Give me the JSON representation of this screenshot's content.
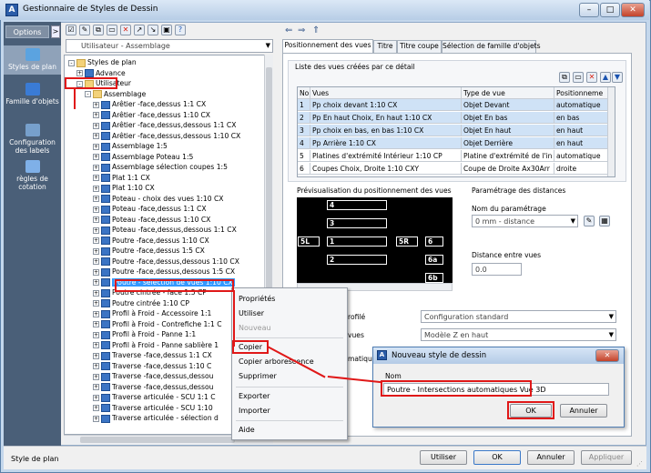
{
  "window": {
    "title": "Gestionnaire de Styles de Dessin"
  },
  "left_panel": {
    "options_label": "Options",
    "toggle": ">",
    "items": [
      {
        "label": "Styles de plan",
        "icon": "styles-plan-icon"
      },
      {
        "label": "Famille d'objets",
        "icon": "famille-objets-icon"
      },
      {
        "label": "Configuration des labels",
        "icon": "configuration-labels-icon"
      },
      {
        "label": "règles de cotation",
        "icon": "regles-cotation-icon"
      }
    ]
  },
  "filter_combo": {
    "value": "Utilisateur - Assemblage"
  },
  "tree": {
    "rows": [
      {
        "text": "Styles de plan",
        "indent": 0,
        "exp": "-",
        "folder": true
      },
      {
        "text": "Advance",
        "indent": 1,
        "exp": "+",
        "folder": false
      },
      {
        "text": "Utilisateur",
        "indent": 1,
        "exp": "-",
        "folder": true
      },
      {
        "text": "Assemblage",
        "indent": 2,
        "exp": "-",
        "folder": true
      },
      {
        "text": "Arêtier -face,dessus 1:1 CX",
        "indent": 3,
        "exp": "+",
        "folder": false
      },
      {
        "text": "Arêtier -face,dessus 1:10 CX",
        "indent": 3,
        "exp": "+",
        "folder": false
      },
      {
        "text": "Arêtier -face,dessus,dessous 1:1 CX",
        "indent": 3,
        "exp": "+",
        "folder": false
      },
      {
        "text": "Arêtier -face,dessus,dessous 1:10 CX",
        "indent": 3,
        "exp": "+",
        "folder": false
      },
      {
        "text": "Assemblage 1:5",
        "indent": 3,
        "exp": "+",
        "folder": false
      },
      {
        "text": "Assemblage Poteau 1:5",
        "indent": 3,
        "exp": "+",
        "folder": false
      },
      {
        "text": "Assemblage sélection coupes 1:5",
        "indent": 3,
        "exp": "+",
        "folder": false
      },
      {
        "text": "Plat 1:1 CX",
        "indent": 3,
        "exp": "+",
        "folder": false
      },
      {
        "text": "Plat 1:10 CX",
        "indent": 3,
        "exp": "+",
        "folder": false
      },
      {
        "text": "Poteau - choix des vues 1:10 CX",
        "indent": 3,
        "exp": "+",
        "folder": false
      },
      {
        "text": "Poteau -face,dessus 1:1 CX",
        "indent": 3,
        "exp": "+",
        "folder": false
      },
      {
        "text": "Poteau -face,dessus 1:10 CX",
        "indent": 3,
        "exp": "+",
        "folder": false
      },
      {
        "text": "Poteau -face,dessus,dessous 1:1 CX",
        "indent": 3,
        "exp": "+",
        "folder": false
      },
      {
        "text": "Poutre -face,dessus 1:10 CX",
        "indent": 3,
        "exp": "+",
        "folder": false
      },
      {
        "text": "Poutre -face,dessus 1:5 CX",
        "indent": 3,
        "exp": "+",
        "folder": false
      },
      {
        "text": "Poutre -face,dessus,dessous 1:10 CX",
        "indent": 3,
        "exp": "+",
        "folder": false
      },
      {
        "text": "Poutre -face,dessus,dessous 1:5 CX",
        "indent": 3,
        "exp": "+",
        "folder": false
      },
      {
        "text": "Poutre - sélection de vues 1:10 CX",
        "indent": 3,
        "exp": "+",
        "folder": false,
        "selected": true
      },
      {
        "text": "Poutre cintrée - face 1:5 CP",
        "indent": 3,
        "exp": "+",
        "folder": false
      },
      {
        "text": "Poutre cintrée 1:10 CP",
        "indent": 3,
        "exp": "+",
        "folder": false
      },
      {
        "text": "Profil à Froid - Accessoire 1:1",
        "indent": 3,
        "exp": "+",
        "folder": false
      },
      {
        "text": "Profil à Froid - Contrefiche 1:1 C",
        "indent": 3,
        "exp": "+",
        "folder": false
      },
      {
        "text": "Profil à Froid - Panne 1:1",
        "indent": 3,
        "exp": "+",
        "folder": false
      },
      {
        "text": "Profil à Froid - Panne sablière 1",
        "indent": 3,
        "exp": "+",
        "folder": false
      },
      {
        "text": "Traverse -face,dessus 1:1 CX",
        "indent": 3,
        "exp": "+",
        "folder": false
      },
      {
        "text": "Traverse -face,dessus 1:10 C",
        "indent": 3,
        "exp": "+",
        "folder": false
      },
      {
        "text": "Traverse -face,dessus,dessou",
        "indent": 3,
        "exp": "+",
        "folder": false
      },
      {
        "text": "Traverse -face,dessus,dessou",
        "indent": 3,
        "exp": "+",
        "folder": false
      },
      {
        "text": "Traverse articulée - SCU 1:1 C",
        "indent": 3,
        "exp": "+",
        "folder": false
      },
      {
        "text": "Traverse articulée - SCU 1:10",
        "indent": 3,
        "exp": "+",
        "folder": false
      },
      {
        "text": "Traverse articulée - sélection d",
        "indent": 3,
        "exp": "+",
        "folder": false
      }
    ]
  },
  "tabs": [
    {
      "label": "Positionnement des vues",
      "active": true
    },
    {
      "label": "Titre",
      "active": false
    },
    {
      "label": "Titre coupe",
      "active": false
    },
    {
      "label": "Sélection de famille d'objets",
      "active": false
    }
  ],
  "views_list": {
    "caption": "Liste des vues créées par ce détail",
    "columns": [
      "No",
      "Vues",
      "Type de vue",
      "Positionneme"
    ],
    "rows": [
      [
        "1",
        "Pp choix devant 1:10 CX",
        "Objet Devant",
        "automatique"
      ],
      [
        "2",
        "Pp En haut Choix, En haut 1:10 CX",
        "Objet En bas",
        "en bas"
      ],
      [
        "3",
        "Pp choix en bas, en bas 1:10 CX",
        "Objet En haut",
        "en haut"
      ],
      [
        "4",
        "Pp Arrière 1:10 CX",
        "Objet Derrière",
        "en haut"
      ],
      [
        "5",
        "Platines d'extrémité Intérieur 1:10 CP",
        "Platine d'extrémité de l'in",
        "automatique"
      ],
      [
        "6",
        "Coupes Choix, Droite 1:10 CXY",
        "Coupe de Droite Ax30Arr",
        "droite"
      ]
    ]
  },
  "preview": {
    "caption": "Prévisualisation du positionnement des vues",
    "labels": [
      "4",
      "3",
      "5L",
      "1",
      "5R",
      "6",
      "2",
      "6a",
      "6b"
    ]
  },
  "distances": {
    "caption": "Paramétrage des distances",
    "name_label": "Nom du paramétrage",
    "name_value": "0 mm - distance",
    "distance_label": "Distance entre vues",
    "distance_value": "0.0"
  },
  "lower_options": {
    "label1": "rofilé",
    "value1": "Configuration standard",
    "label2": "vues",
    "value2": "Modèle Z en haut",
    "label3": "matique"
  },
  "context_menu": {
    "items": [
      {
        "label": "Propriétés",
        "disabled": false
      },
      {
        "label": "Utiliser",
        "disabled": false
      },
      {
        "label": "Nouveau",
        "disabled": true
      },
      {
        "label": "Copier",
        "disabled": false
      },
      {
        "label": "Copier arborescence",
        "disabled": false
      },
      {
        "label": "Supprimer",
        "disabled": false
      },
      {
        "label": "Exporter",
        "disabled": false
      },
      {
        "label": "Importer",
        "disabled": false
      },
      {
        "label": "Aide",
        "disabled": false
      }
    ]
  },
  "new_style_dialog": {
    "title": "Nouveau style de dessin",
    "name_label": "Nom",
    "name_value": "Poutre - Intersections automatiques Vue 3D",
    "ok": "OK",
    "cancel": "Annuler"
  },
  "status_bar": {
    "text": "Style de plan"
  },
  "bottom_buttons": {
    "use": "Utiliser",
    "ok": "OK",
    "cancel": "Annuler",
    "apply": "Appliquer"
  },
  "colors": {
    "highlight": "#e01818",
    "selection": "#3399ff",
    "sidebar": "#4a5f78"
  }
}
